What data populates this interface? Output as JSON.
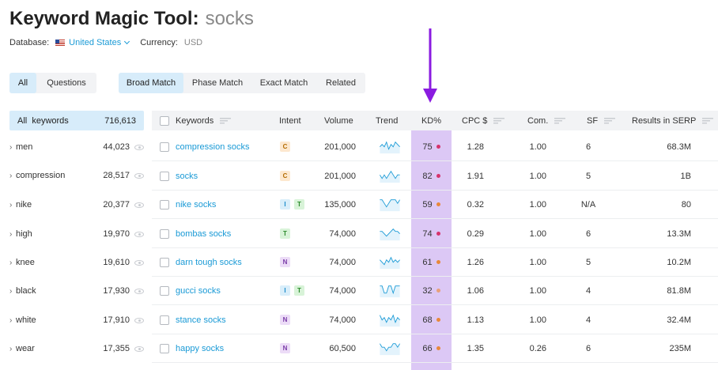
{
  "header": {
    "title": "Keyword Magic Tool:",
    "query": "socks"
  },
  "meta": {
    "database_label": "Database:",
    "database_value": "United States",
    "currency_label": "Currency:",
    "currency_value": "USD"
  },
  "tabs_type": [
    {
      "label": "All",
      "active": true
    },
    {
      "label": "Questions",
      "active": false
    }
  ],
  "tabs_match": [
    {
      "label": "Broad Match",
      "active": true
    },
    {
      "label": "Phase Match",
      "active": false
    },
    {
      "label": "Exact Match",
      "active": false
    },
    {
      "label": "Related",
      "active": false
    }
  ],
  "sidebar": {
    "all_label": "All  keywords",
    "all_count": "716,613",
    "groups": [
      {
        "name": "men",
        "count": "44,023"
      },
      {
        "name": "compression",
        "count": "28,517"
      },
      {
        "name": "nike",
        "count": "20,377"
      },
      {
        "name": "high",
        "count": "19,970"
      },
      {
        "name": "knee",
        "count": "19,610"
      },
      {
        "name": "black",
        "count": "17,930"
      },
      {
        "name": "white",
        "count": "17,910"
      },
      {
        "name": "wear",
        "count": "17,355"
      }
    ]
  },
  "table": {
    "headers": {
      "keywords": "Keywords",
      "intent": "Intent",
      "volume": "Volume",
      "trend": "Trend",
      "kd": "KD%",
      "cpc": "CPC $",
      "com": "Com.",
      "sf": "SF",
      "results": "Results in SERP"
    },
    "rows": [
      {
        "keyword": "compression socks",
        "intent": [
          "C"
        ],
        "volume": "201,000",
        "kd": "75",
        "kd_color": "#d6336c",
        "cpc": "1.28",
        "com": "1.00",
        "sf": "6",
        "results": "68.3M",
        "trend": [
          4,
          5,
          4,
          6,
          3,
          5,
          4,
          6,
          5,
          4
        ]
      },
      {
        "keyword": "socks",
        "intent": [
          "C"
        ],
        "volume": "201,000",
        "kd": "82",
        "kd_color": "#d6336c",
        "cpc": "1.91",
        "com": "1.00",
        "sf": "5",
        "results": "1B",
        "trend": [
          5,
          4,
          5,
          4,
          5,
          6,
          5,
          4,
          5,
          5
        ]
      },
      {
        "keyword": "nike socks",
        "intent": [
          "I",
          "T"
        ],
        "volume": "135,000",
        "kd": "59",
        "kd_color": "#e8883a",
        "cpc": "0.32",
        "com": "1.00",
        "sf": "N/A",
        "results": "80",
        "trend": [
          5,
          5,
          4,
          3,
          4,
          5,
          5,
          5,
          4,
          5
        ]
      },
      {
        "keyword": "bombas socks",
        "intent": [
          "T"
        ],
        "volume": "74,000",
        "kd": "74",
        "kd_color": "#d6336c",
        "cpc": "0.29",
        "com": "1.00",
        "sf": "6",
        "results": "13.3M",
        "trend": [
          5,
          5,
          4,
          3,
          4,
          5,
          6,
          5,
          5,
          4
        ]
      },
      {
        "keyword": "darn tough socks",
        "intent": [
          "N"
        ],
        "volume": "74,000",
        "kd": "61",
        "kd_color": "#e8883a",
        "cpc": "1.26",
        "com": "1.00",
        "sf": "5",
        "results": "10.2M",
        "trend": [
          5,
          4,
          3,
          5,
          4,
          6,
          4,
          5,
          4,
          5
        ]
      },
      {
        "keyword": "gucci socks",
        "intent": [
          "I",
          "T"
        ],
        "volume": "74,000",
        "kd": "32",
        "kd_color": "#e8a07a",
        "cpc": "1.06",
        "com": "1.00",
        "sf": "4",
        "results": "81.8M",
        "trend": [
          5,
          5,
          4,
          4,
          5,
          5,
          4,
          5,
          5,
          5
        ]
      },
      {
        "keyword": "stance socks",
        "intent": [
          "N"
        ],
        "volume": "74,000",
        "kd": "68",
        "kd_color": "#e8883a",
        "cpc": "1.13",
        "com": "1.00",
        "sf": "4",
        "results": "32.4M",
        "trend": [
          6,
          4,
          5,
          3,
          5,
          4,
          6,
          3,
          5,
          4
        ]
      },
      {
        "keyword": "happy socks",
        "intent": [
          "N"
        ],
        "volume": "60,500",
        "kd": "66",
        "kd_color": "#e8883a",
        "cpc": "1.35",
        "com": "0.26",
        "sf": "6",
        "results": "235M",
        "trend": [
          5,
          4,
          4,
          3,
          4,
          4,
          5,
          5,
          4,
          5
        ]
      }
    ]
  },
  "colors": {
    "accent": "#1a9ad6",
    "kd_highlight": "#dcc8f5",
    "arrow": "#8a1be0"
  }
}
